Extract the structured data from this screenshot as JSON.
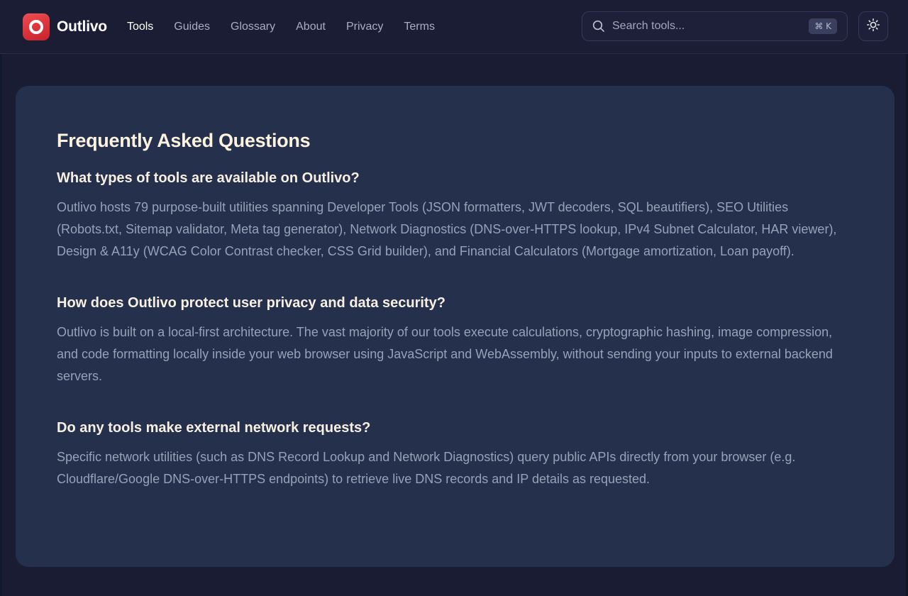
{
  "brand": {
    "name": "Outlivo",
    "logo_color": "#e53a40"
  },
  "nav": {
    "items": [
      {
        "label": "Tools",
        "active": true
      },
      {
        "label": "Guides",
        "active": false
      },
      {
        "label": "Glossary",
        "active": false
      },
      {
        "label": "About",
        "active": false
      },
      {
        "label": "Privacy",
        "active": false
      },
      {
        "label": "Terms",
        "active": false
      }
    ]
  },
  "search": {
    "placeholder": "Search tools...",
    "shortcut": "⌘ K",
    "icon": "search-icon"
  },
  "theme_toggle": {
    "icon": "sun-icon"
  },
  "faq": {
    "title": "Frequently Asked Questions",
    "items": [
      {
        "question": "What types of tools are available on Outlivo?",
        "answer": "Outlivo hosts 79 purpose-built utilities spanning Developer Tools (JSON formatters, JWT decoders, SQL beautifiers), SEO Utilities (Robots.txt, Sitemap validator, Meta tag generator), Network Diagnostics (DNS-over-HTTPS lookup, IPv4 Subnet Calculator, HAR viewer), Design & A11y (WCAG Color Contrast checker, CSS Grid builder), and Financial Calculators (Mortgage amortization, Loan payoff)."
      },
      {
        "question": "How does Outlivo protect user privacy and data security?",
        "answer": "Outlivo is built on a local-first architecture. The vast majority of our tools execute calculations, cryptographic hashing, image compression, and code formatting locally inside your web browser using JavaScript and WebAssembly, without sending your inputs to external backend servers."
      },
      {
        "question": "Do any tools make external network requests?",
        "answer": "Specific network utilities (such as DNS Record Lookup and Network Diagnostics) query public APIs directly from your browser (e.g. Cloudflare/Google DNS-over-HTTPS endpoints) to retrieve live DNS records and IP details as requested."
      }
    ]
  },
  "colors": {
    "background": "#1a1c33",
    "card": "#24304c",
    "heading": "#fdf3df",
    "body_text": "#98a1b8"
  }
}
